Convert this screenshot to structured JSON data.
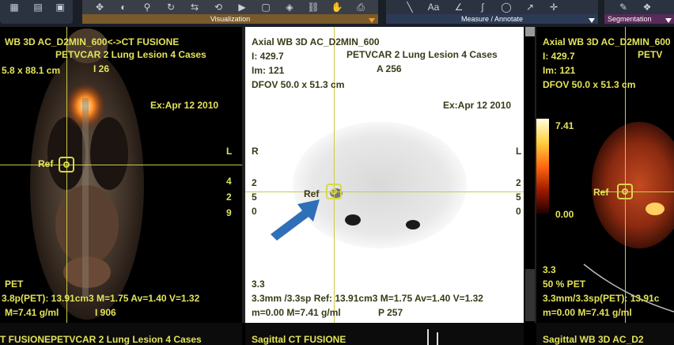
{
  "toolbar": {
    "visualization_label": "Visualization",
    "measure_label": "Measure / Annotate",
    "segmentation_label": "Segmentation",
    "aa_label": "Aa"
  },
  "left_viewport": {
    "title": "WB 3D AC_D2MIN_600<->CT FUSIONE",
    "subtitle": "PETVCAR 2 Lung Lesion 4 Cases",
    "fov": "5.8 x 88.1 cm",
    "orient_top": "I 26",
    "date": "Ex:Apr 12 2010",
    "orient_right": "L",
    "ref_label": "Ref",
    "num1": "4",
    "num2": "2",
    "num3": "9",
    "pet_label": "PET",
    "stats": "3.8p(PET): 13.91cm3 M=1.75 Av=1.40 V=1.32",
    "value_line": "M=7.41 g/ml",
    "orient_bottom": "I 906"
  },
  "center_viewport": {
    "title": "Axial WB 3D AC_D2MIN_600",
    "i_value": "I: 429.7",
    "subtitle": "PETVCAR 2 Lung Lesion 4 Cases",
    "im_value": "Im: 121",
    "orient_top": "A 256",
    "dfov": "DFOV 50.0 x 51.3 cm",
    "date": "Ex:Apr 12 2010",
    "orient_left": "R",
    "orient_right": "L",
    "ref_label": "Ref",
    "num_left": [
      "2",
      "5",
      "0"
    ],
    "num_right": [
      "2",
      "5",
      "0"
    ],
    "thickness": "3.3",
    "stats": "3.3mm /3.3sp Ref: 13.91cm3 M=1.75 Av=1.40 V=1.32",
    "value_line": "m=0.00 M=7.41 g/ml",
    "orient_bottom": "P 257"
  },
  "right_viewport": {
    "title": "Axial WB 3D AC_D2MIN_600",
    "i_value": "I: 429.7",
    "subtitle_partial": "PETV",
    "im_value": "Im: 121",
    "dfov": "DFOV 50.0 x 51.3 cm",
    "scale_max": "7.41",
    "scale_min": "0.00",
    "ref_label": "Ref",
    "thickness": "3.3",
    "pet_percent": "50 % PET",
    "stats": "3.3mm/3.3sp(PET): 13.91c",
    "value_line": "m=0.00 M=7.41 g/ml"
  },
  "bottom_bar": {
    "left_text": "T FUSIONEPETVCAR 2 Lung Lesion 4 Cases",
    "center_text": "Sagittal CT FUSIONE",
    "right_text": "Sagittal WB 3D AC_D2"
  },
  "colors": {
    "overlay_text": "#e3e35a",
    "crosshair": "#c9c94a",
    "arrow": "#2f6fb8"
  }
}
